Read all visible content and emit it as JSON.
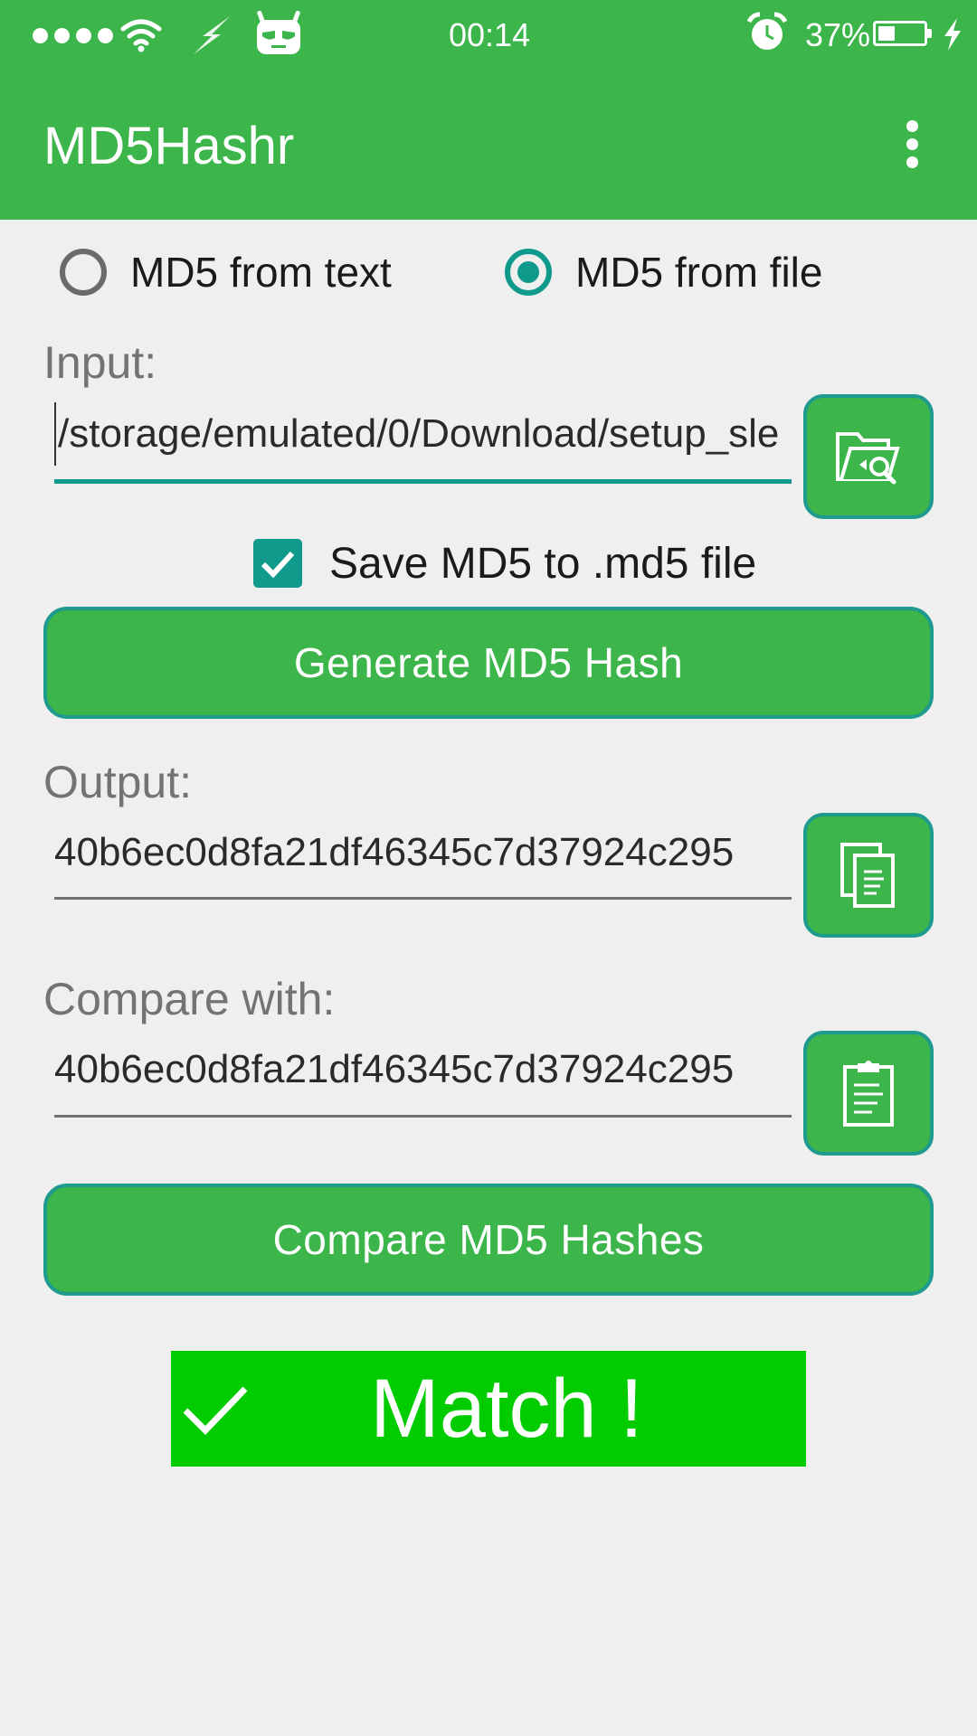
{
  "status_bar": {
    "time": "00:14",
    "battery_percent": "37%",
    "battery_level": 0.37,
    "icons": [
      "signal-dots-icon",
      "wifi-icon",
      "lightning-icon",
      "cyanogen-icon",
      "alarm-icon",
      "battery-icon",
      "charging-icon"
    ]
  },
  "appbar": {
    "title": "MD5Hashr",
    "menu_icon": "overflow-menu-icon"
  },
  "mode": {
    "options": [
      {
        "label": "MD5 from text",
        "selected": false
      },
      {
        "label": "MD5 from file",
        "selected": true
      }
    ]
  },
  "input": {
    "label": "Input:",
    "value": "/storage/emulated/0/Download/setup_sle",
    "browse_icon": "folder-search-icon"
  },
  "save_option": {
    "label": "Save MD5 to .md5 file",
    "checked": true
  },
  "generate_button": {
    "label": "Generate MD5 Hash"
  },
  "output": {
    "label": "Output:",
    "value": "40b6ec0d8fa21df46345c7d37924c295",
    "copy_icon": "copy-icon"
  },
  "compare": {
    "label": "Compare with:",
    "value": "40b6ec0d8fa21df46345c7d37924c295",
    "paste_icon": "clipboard-icon"
  },
  "compare_button": {
    "label": "Compare MD5 Hashes"
  },
  "result": {
    "text": "Match !",
    "icon": "checkmark-icon",
    "color": "#00cc00"
  },
  "colors": {
    "primary": "#3cb54a",
    "accent": "#0f9a8c",
    "background": "#efefef"
  }
}
